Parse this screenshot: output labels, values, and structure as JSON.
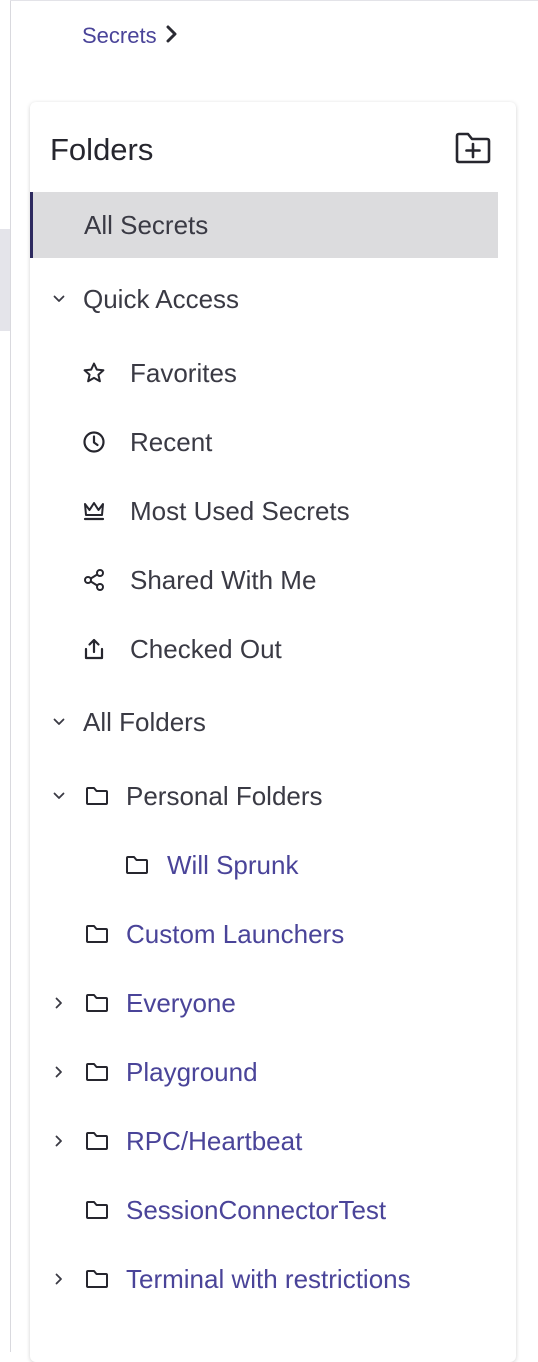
{
  "breadcrumb": {
    "item": "Secrets",
    "separator": "›"
  },
  "panel": {
    "title": "Folders",
    "add_folder_icon": "folder-plus-icon"
  },
  "tree": {
    "all_secrets": "All Secrets",
    "quick_access": {
      "label": "Quick Access",
      "items": [
        {
          "label": "Favorites",
          "icon": "star-icon"
        },
        {
          "label": "Recent",
          "icon": "clock-icon"
        },
        {
          "label": "Most Used Secrets",
          "icon": "crown-icon"
        },
        {
          "label": "Shared With Me",
          "icon": "share-icon"
        },
        {
          "label": "Checked Out",
          "icon": "upload-icon"
        }
      ]
    },
    "all_folders": {
      "label": "All Folders",
      "items": [
        {
          "label": "Personal Folders"
        },
        {
          "label": "Will Sprunk"
        },
        {
          "label": "Custom Launchers"
        },
        {
          "label": "Everyone"
        },
        {
          "label": "Playground"
        },
        {
          "label": "RPC/Heartbeat"
        },
        {
          "label": "SessionConnectorTest"
        },
        {
          "label": "Terminal with restrictions"
        }
      ]
    }
  },
  "colors": {
    "accent": "#4a4499",
    "selected_bg": "#dcdcde",
    "selected_bar": "#2d2a5f"
  }
}
